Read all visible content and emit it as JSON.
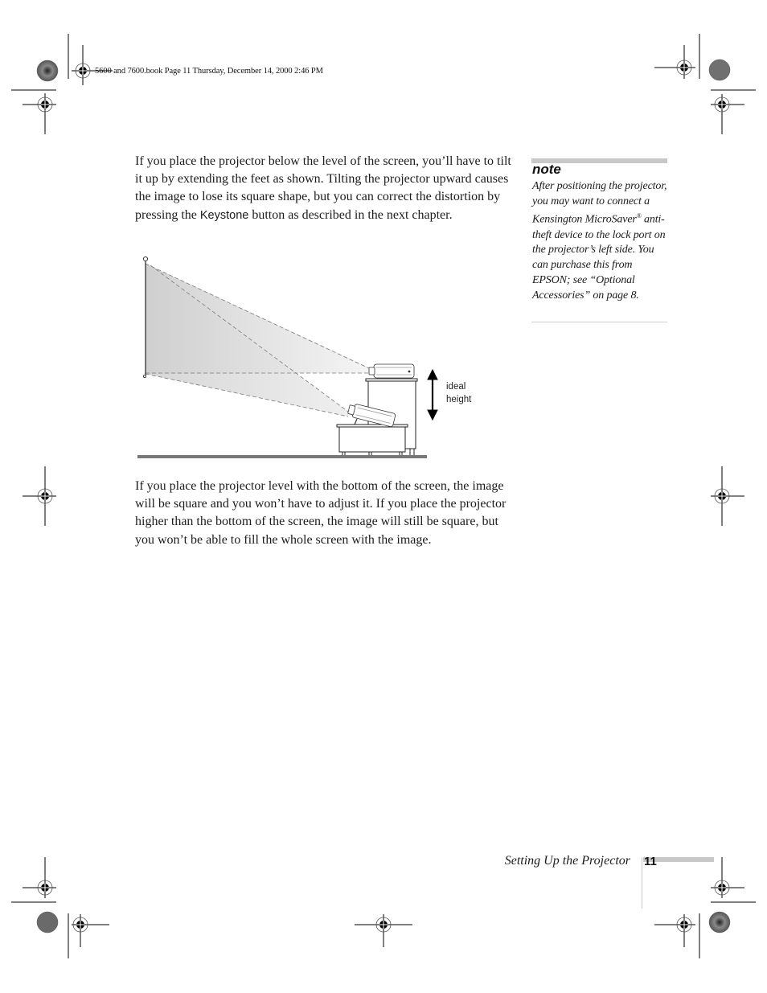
{
  "header": {
    "book_info": "5600 and 7600.book  Page 11  Thursday, December 14, 2000  2:46 PM"
  },
  "main": {
    "paragraph1": {
      "before_keyword": "If you place the projector below the level of the screen, you’ll have to tilt it up by extending the feet as shown. Tilting the projector upward causes the image to lose its square shape, but you can correct the distortion by pressing the ",
      "keyword": "Keystone",
      "after_keyword": " button as described in the next chapter."
    },
    "figure": {
      "label_line1": "ideal",
      "label_line2": "height"
    },
    "paragraph2": "If you place the projector level with the bottom of the screen, the image will be square and you won’t have to adjust it. If you place the projector higher than the bottom of the screen, the image will still be square, but you won’t be able to fill the whole screen with the image."
  },
  "note": {
    "title": "note",
    "text_before_reg": "After positioning the projector, you may want to connect a Kensington MicroSaver",
    "reg_mark": "®",
    "text_after_reg": " anti-theft device to the lock port on the projector’s left side. You can purchase this from EPSON; see “Optional Accessories” on page 8."
  },
  "footer": {
    "section_title": "Setting Up the Projector",
    "page_number": "11"
  }
}
